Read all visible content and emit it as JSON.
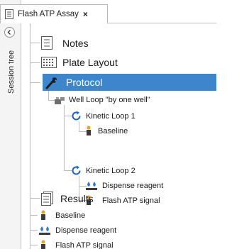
{
  "tab": {
    "title": "Flash ATP Assay",
    "close_glyph": "×"
  },
  "sidebar": {
    "label": "Session tree",
    "collapse_icon": "chevron-left-icon"
  },
  "tree": {
    "notes": "Notes",
    "plate_layout": "Plate Layout",
    "protocol": {
      "label": "Protocol",
      "well_loop": {
        "label": "Well Loop \"by one well\"",
        "kinetic_loop_1": {
          "label": "Kinetic Loop 1",
          "children": [
            "Baseline"
          ]
        },
        "kinetic_loop_2": {
          "label": "Kinetic Loop 2",
          "children": [
            "Dispense reagent",
            "Flash ATP signal"
          ]
        }
      }
    },
    "results": {
      "label": "Results",
      "children": [
        "Baseline",
        "Dispense reagent",
        "Flash ATP signal"
      ]
    }
  },
  "colors": {
    "selection": "#3d86cd",
    "loop_icon": "#1c62c8",
    "read_icon": "#e8a417",
    "dispense_icon": "#2a78d6"
  }
}
